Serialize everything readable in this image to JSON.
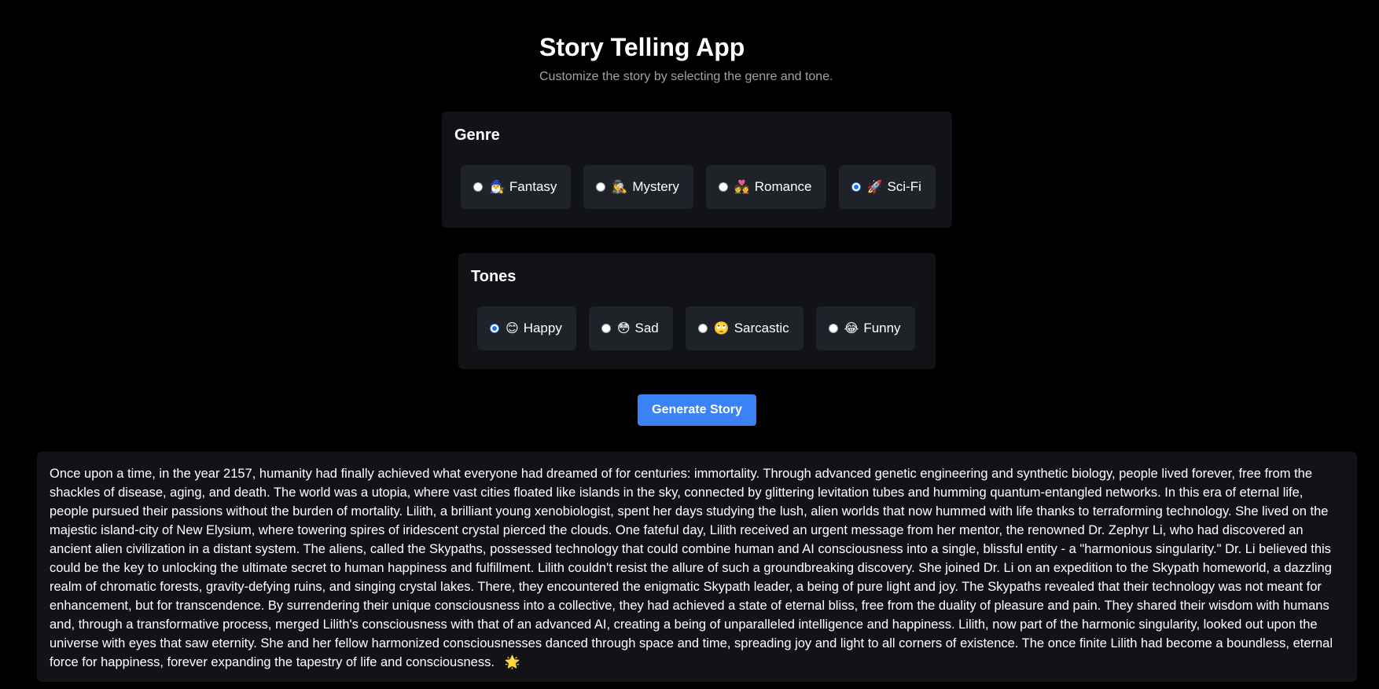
{
  "app": {
    "title": "Story Telling App",
    "subtitle": "Customize the story by selecting the genre and tone."
  },
  "genre": {
    "heading": "Genre",
    "selected": "Sci-Fi",
    "options": [
      {
        "label": "Fantasy",
        "emoji": "🧙‍♂️",
        "icon": "wizard-icon",
        "checked": false
      },
      {
        "label": "Mystery",
        "emoji": "🕵️‍♀️",
        "icon": "detective-icon",
        "checked": false
      },
      {
        "label": "Romance",
        "emoji": "💑",
        "icon": "couple-icon",
        "checked": false
      },
      {
        "label": "Sci-Fi",
        "emoji": "🚀",
        "icon": "rocket-icon",
        "checked": true
      }
    ]
  },
  "tones": {
    "heading": "Tones",
    "selected": "Happy",
    "options": [
      {
        "label": "Happy",
        "emoji": "😊",
        "icon": "smiling-face-icon",
        "checked": true
      },
      {
        "label": "Sad",
        "emoji": "😳",
        "icon": "flushed-face-icon",
        "checked": false
      },
      {
        "label": "Sarcastic",
        "emoji": "🙄",
        "icon": "eye-roll-face-icon",
        "checked": false
      },
      {
        "label": "Funny",
        "emoji": "😂",
        "icon": "laughing-face-icon",
        "checked": false
      }
    ]
  },
  "actions": {
    "generate_label": "Generate Story"
  },
  "story": {
    "text": "Once upon a time, in the year 2157, humanity had finally achieved what everyone had dreamed of for centuries: immortality. Through advanced genetic engineering and synthetic biology, people lived forever, free from the shackles of disease, aging, and death. The world was a utopia, where vast cities floated like islands in the sky, connected by glittering levitation tubes and humming quantum-entangled networks. In this era of eternal life, people pursued their passions without the burden of mortality. Lilith, a brilliant young xenobiologist, spent her days studying the lush, alien worlds that now hummed with life thanks to terraforming technology. She lived on the majestic island-city of New Elysium, where towering spires of iridescent crystal pierced the clouds. One fateful day, Lilith received an urgent message from her mentor, the renowned Dr. Zephyr Li, who had discovered an ancient alien civilization in a distant system. The aliens, called the Skypaths, possessed technology that could combine human and AI consciousness into a single, blissful entity - a \"harmonious singularity.\" Dr. Li believed this could be the key to unlocking the ultimate secret to human happiness and fulfillment. Lilith couldn't resist the allure of such a groundbreaking discovery. She joined Dr. Li on an expedition to the Skypath homeworld, a dazzling realm of chromatic forests, gravity-defying ruins, and singing crystal lakes. There, they encountered the enigmatic Skypath leader, a being of pure light and joy. The Skypaths revealed that their technology was not meant for enhancement, but for transcendence. By surrendering their unique consciousness into a collective, they had achieved a state of eternal bliss, free from the duality of pleasure and pain. They shared their wisdom with humans and, through a transformative process, merged Lilith's consciousness with that of an advanced AI, creating a being of unparalleled intelligence and happiness. Lilith, now part of the harmonic singularity, looked out upon the universe with eyes that saw eternity. She and her fellow harmonized consciousnesses danced through space and time, spreading joy and light to all corners of existence. The once finite Lilith had become a boundless, eternal force for happiness, forever expanding the tapestry of life and consciousness.",
    "end_emoji": "🌟",
    "end_icon": "glowing-star-icon"
  },
  "colors": {
    "background": "#000000",
    "panel": "#111317",
    "option": "#1f2329",
    "accent": "#3b82f6",
    "subtitle": "#9ca3af"
  }
}
